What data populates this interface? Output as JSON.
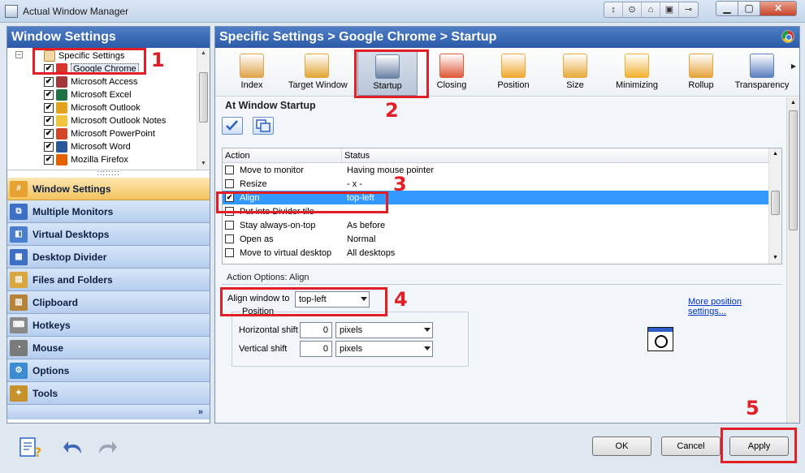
{
  "window": {
    "title": "Actual Window Manager",
    "toolbar_tools": [
      "↕",
      "⊙",
      "⌂",
      "▣",
      "⊸"
    ],
    "min": "▁",
    "max": "▢",
    "close": "✕"
  },
  "left": {
    "header": "Window Settings",
    "tree": {
      "expander": "−",
      "root": "Specific Settings",
      "items": [
        {
          "label": "Google Chrome",
          "checked": "✔",
          "icon_color": "#d8342c",
          "icon_name": "chrome-icon"
        },
        {
          "label": "Microsoft Access",
          "checked": "✔",
          "icon_color": "#a4373a",
          "icon_name": "access-icon"
        },
        {
          "label": "Microsoft Excel",
          "checked": "✔",
          "icon_color": "#1e7145",
          "icon_name": "excel-icon"
        },
        {
          "label": "Microsoft Outlook",
          "checked": "✔",
          "icon_color": "#e3a21a",
          "icon_name": "outlook-icon"
        },
        {
          "label": "Microsoft Outlook Notes",
          "checked": "✔",
          "icon_color": "#f2c43d",
          "icon_name": "notes-icon"
        },
        {
          "label": "Microsoft PowerPoint",
          "checked": "✔",
          "icon_color": "#d24726",
          "icon_name": "powerpoint-icon"
        },
        {
          "label": "Microsoft Word",
          "checked": "✔",
          "icon_color": "#2b579a",
          "icon_name": "word-icon"
        },
        {
          "label": "Mozilla Firefox",
          "checked": "✔",
          "icon_color": "#e66000",
          "icon_name": "firefox-icon"
        }
      ]
    },
    "grip": "::::::::",
    "nav": [
      {
        "label": "Window Settings",
        "icon": "#",
        "icon_color": "#e8a232",
        "active": true
      },
      {
        "label": "Multiple Monitors",
        "icon": "⧉",
        "icon_color": "#3d6fc4"
      },
      {
        "label": "Virtual Desktops",
        "icon": "◧",
        "icon_color": "#4a7fd0"
      },
      {
        "label": "Desktop Divider",
        "icon": "▦",
        "icon_color": "#3d6fc4"
      },
      {
        "label": "Files and Folders",
        "icon": "▤",
        "icon_color": "#d9a640"
      },
      {
        "label": "Clipboard",
        "icon": "▥",
        "icon_color": "#b5833a"
      },
      {
        "label": "Hotkeys",
        "icon": "⌨",
        "icon_color": "#8a8a8a"
      },
      {
        "label": "Mouse",
        "icon": "◔",
        "icon_color": "#7a7a7a"
      },
      {
        "label": "Options",
        "icon": "⚙",
        "icon_color": "#3d8bd0"
      },
      {
        "label": "Tools",
        "icon": "✦",
        "icon_color": "#c7922c"
      }
    ],
    "more": "»"
  },
  "right": {
    "header": "Specific Settings > Google Chrome > Startup",
    "tools": [
      {
        "label": "Index",
        "color": "#e0a54a",
        "selected": false
      },
      {
        "label": "Target Window",
        "color": "#e2a636",
        "selected": false
      },
      {
        "label": "Startup",
        "color": "#6a82a6",
        "selected": true
      },
      {
        "label": "Closing",
        "color": "#e05a3a",
        "selected": false
      },
      {
        "label": "Position",
        "color": "#f0a830",
        "selected": false
      },
      {
        "label": "Size",
        "color": "#e8a93a",
        "selected": false
      },
      {
        "label": "Minimizing",
        "color": "#f2b131",
        "selected": false
      },
      {
        "label": "Rollup",
        "color": "#e5a33a",
        "selected": false
      },
      {
        "label": "Transparency",
        "color": "#5c7fc0",
        "selected": false
      }
    ],
    "more_arrow": "▶",
    "section_title": "At Window Startup",
    "grid": {
      "col_action": "Action",
      "col_status": "Status",
      "rows": [
        {
          "action": "Move to monitor",
          "status": "Having mouse pointer",
          "checked": ""
        },
        {
          "action": "Resize",
          "status": "- x -",
          "checked": ""
        },
        {
          "action": "Align",
          "status": "top-left",
          "checked": "✔",
          "selected": true
        },
        {
          "action": "Put into Divider tile",
          "status": "",
          "checked": ""
        },
        {
          "action": "Stay always-on-top",
          "status": "As before",
          "checked": ""
        },
        {
          "action": "Open as",
          "status": "Normal",
          "checked": ""
        },
        {
          "action": "Move to virtual desktop",
          "status": "All desktops",
          "checked": ""
        }
      ]
    },
    "options": {
      "title": "Action Options: Align",
      "align_label": "Align window to",
      "align_value": "top-left",
      "more_link": "More position settings...",
      "position_title": "Position",
      "h_label": "Horizontal shift",
      "h_value": "0",
      "h_unit": "pixels",
      "v_label": "Vertical shift",
      "v_value": "0",
      "v_unit": "pixels"
    }
  },
  "buttons": {
    "ok": "OK",
    "cancel": "Cancel",
    "apply": "Apply"
  },
  "annotations": {
    "n1": "1",
    "n2": "2",
    "n3": "3",
    "n4": "4",
    "n5": "5",
    "color": "#e21e26"
  }
}
